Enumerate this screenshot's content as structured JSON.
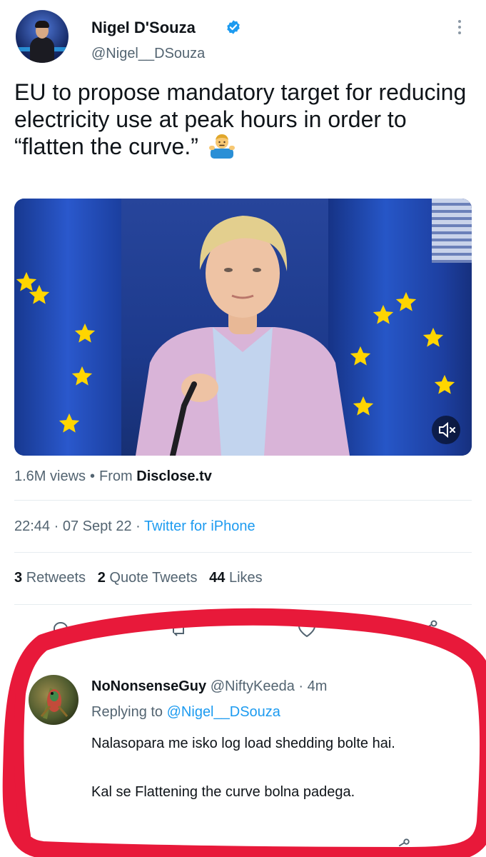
{
  "tweet": {
    "author_name": "Nigel D'Souza",
    "author_handle": "@Nigel__DSouza",
    "text": "EU to propose mandatory target for reducing electricity use at peak hours in order to “flatten the curve.”",
    "views_count": "1.6M views",
    "separator": "•",
    "from_label": "From",
    "source_account": "Disclose.tv",
    "time": "22:44 · 07 Sept 22",
    "meta_separator": "·",
    "client": "Twitter for iPhone",
    "retweets_count": "3",
    "retweets_label": "Retweets",
    "quotes_count": "2",
    "quotes_label": "Quote Tweets",
    "likes_count": "44",
    "likes_label": "Likes",
    "emoji_icon": "man-shrugging-emoji",
    "verified_icon": "verified-badge-icon"
  },
  "reply": {
    "author_name": "NoNonsenseGuy",
    "author_handle": "@NiftyKeeda",
    "age": "· 4m",
    "replying_label": "Replying to",
    "replying_to": "@Nigel__DSouza",
    "text_para1": "Nalasopara me isko log load shedding bolte hai.",
    "text_para2": "Kal se Flattening the curve bolna padega."
  },
  "colors": {
    "accent": "#1d9bf0",
    "text": "#0f1419",
    "muted": "#536471",
    "annotation_circle": "#e8193a"
  }
}
